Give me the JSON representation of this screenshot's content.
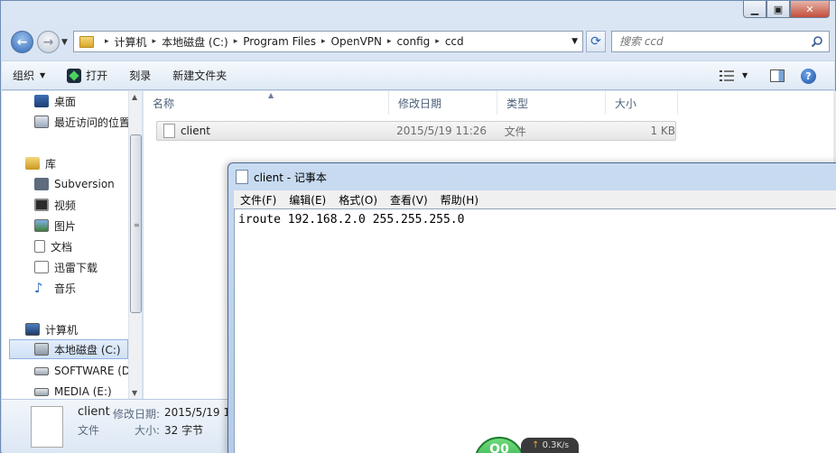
{
  "breadcrumbs": [
    "计算机",
    "本地磁盘 (C:)",
    "Program Files",
    "OpenVPN",
    "config",
    "ccd"
  ],
  "search": {
    "placeholder": "搜索 ccd"
  },
  "toolbar": {
    "organize": "组织",
    "open": "打开",
    "burn": "刻录",
    "new_folder": "新建文件夹"
  },
  "nav": {
    "favorites": [
      {
        "label": "桌面",
        "icon": "desktop-icon"
      },
      {
        "label": "最近访问的位置",
        "icon": "recent-places-icon"
      }
    ],
    "libraries_label": "库",
    "libraries": [
      {
        "label": "Subversion",
        "icon": "subversion-icon"
      },
      {
        "label": "视频",
        "icon": "video-icon"
      },
      {
        "label": "图片",
        "icon": "pictures-icon"
      },
      {
        "label": "文档",
        "icon": "documents-icon"
      },
      {
        "label": "迅雷下载",
        "icon": "thunder-download-icon"
      },
      {
        "label": "音乐",
        "icon": "music-icon"
      }
    ],
    "computer_label": "计算机",
    "drives": [
      {
        "label": "本地磁盘 (C:)",
        "icon": "local-disk-icon",
        "selected": true
      },
      {
        "label": "SOFTWARE (D",
        "icon": "drive-icon"
      },
      {
        "label": "MEDIA (E:)",
        "icon": "drive-icon"
      }
    ]
  },
  "columns": {
    "name": "名称",
    "modified": "修改日期",
    "type": "类型",
    "size": "大小"
  },
  "files": [
    {
      "name": "client",
      "modified": "2015/5/19 11:26",
      "type": "文件",
      "size": "1 KB"
    }
  ],
  "details": {
    "name": "client",
    "modified_label": "修改日期:",
    "modified_value": "2015/5/19 1",
    "type": "文件",
    "size_label": "大小:",
    "size_value": "32 字节"
  },
  "notepad": {
    "title": "client - 记事本",
    "menus": [
      "文件(F)",
      "编辑(E)",
      "格式(O)",
      "查看(V)",
      "帮助(H)"
    ],
    "content": "iroute 192.168.2.0 255.255.255.0"
  },
  "speed_widget": {
    "ball_text": "Q0",
    "arrow": "↑",
    "rate": "0.3",
    "unit": "K/s"
  },
  "colors": {
    "accent": "#2f68b8",
    "title_bar": "#c8dbf1",
    "widget_green": "#2ea544"
  }
}
